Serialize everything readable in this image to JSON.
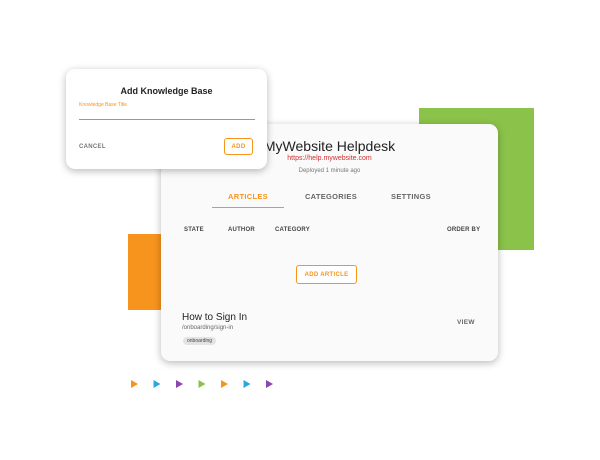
{
  "dialog": {
    "title": "Add Knowledge Base",
    "field_label": "Knowledge Base Title",
    "field_value": "",
    "cancel_label": "CANCEL",
    "add_label": "ADD"
  },
  "helpdesk": {
    "title": "MyWebsite Helpdesk",
    "url": "https://help.mywebsite.com",
    "deployed": "Deployed 1 minute ago",
    "tabs": [
      {
        "label": "ARTICLES",
        "active": true
      },
      {
        "label": "CATEGORIES",
        "active": false
      },
      {
        "label": "SETTINGS",
        "active": false
      }
    ],
    "columns": [
      "STATE",
      "AUTHOR",
      "CATEGORY",
      "ORDER BY"
    ],
    "add_article_label": "ADD ARTICLE",
    "articles": [
      {
        "title": "How to Sign In",
        "path": "/onboarding/sign-in",
        "tag": "onboarding",
        "action": "VIEW"
      }
    ]
  },
  "colors": {
    "accent": "#f7941d",
    "green": "#8bc34a",
    "url": "#d32f2f",
    "arrow_sequence": [
      "#f7941d",
      "#29a8e0",
      "#8e44ad",
      "#8bc34a",
      "#f7941d",
      "#29a8e0",
      "#8e44ad"
    ]
  },
  "icons": [
    "play-arrow-icon"
  ]
}
